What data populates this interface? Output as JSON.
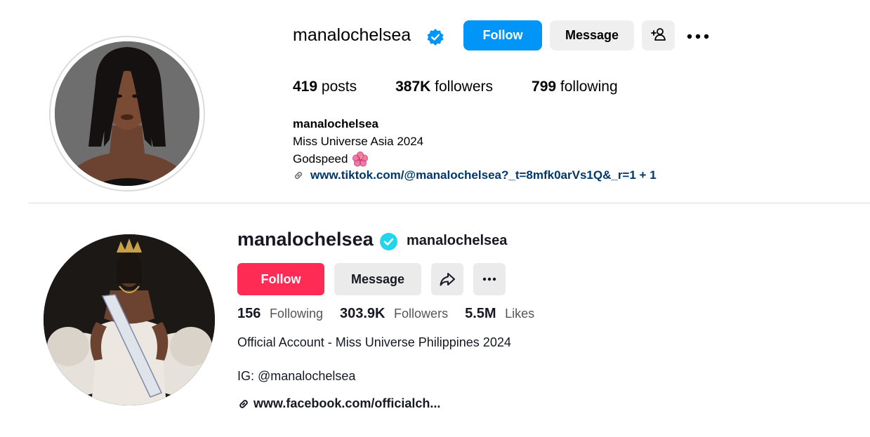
{
  "instagram": {
    "username": "manalochelsea",
    "verified": true,
    "follow_label": "Follow",
    "message_label": "Message",
    "stats": [
      {
        "value": "419",
        "label": "posts"
      },
      {
        "value": "387K",
        "label": "followers"
      },
      {
        "value": "799",
        "label": "following"
      }
    ],
    "name": "manalochelsea",
    "bio_line1": "Miss Universe Asia 2024",
    "bio_line2": "Godspeed",
    "link": "www.tiktok.com/@manalochelsea?_t=8mfk0arVs1Q&_r=1 + 1",
    "colors": {
      "follow": "#0095f6",
      "badge": "#0095f6",
      "link": "#00376b"
    }
  },
  "tiktok": {
    "username": "manalochelsea",
    "handle": "manalochelsea",
    "verified": true,
    "follow_label": "Follow",
    "message_label": "Message",
    "stats": [
      {
        "value": "156",
        "label": "Following"
      },
      {
        "value": "303.9K",
        "label": "Followers"
      },
      {
        "value": "5.5M",
        "label": "Likes"
      }
    ],
    "bio_line1": "Official Account - Miss Universe Philippines 2024",
    "bio_line2": "IG: @manalochelsea",
    "link": "www.facebook.com/officialch...",
    "colors": {
      "follow": "#fe2c55",
      "badge": "#20d5ec"
    }
  }
}
